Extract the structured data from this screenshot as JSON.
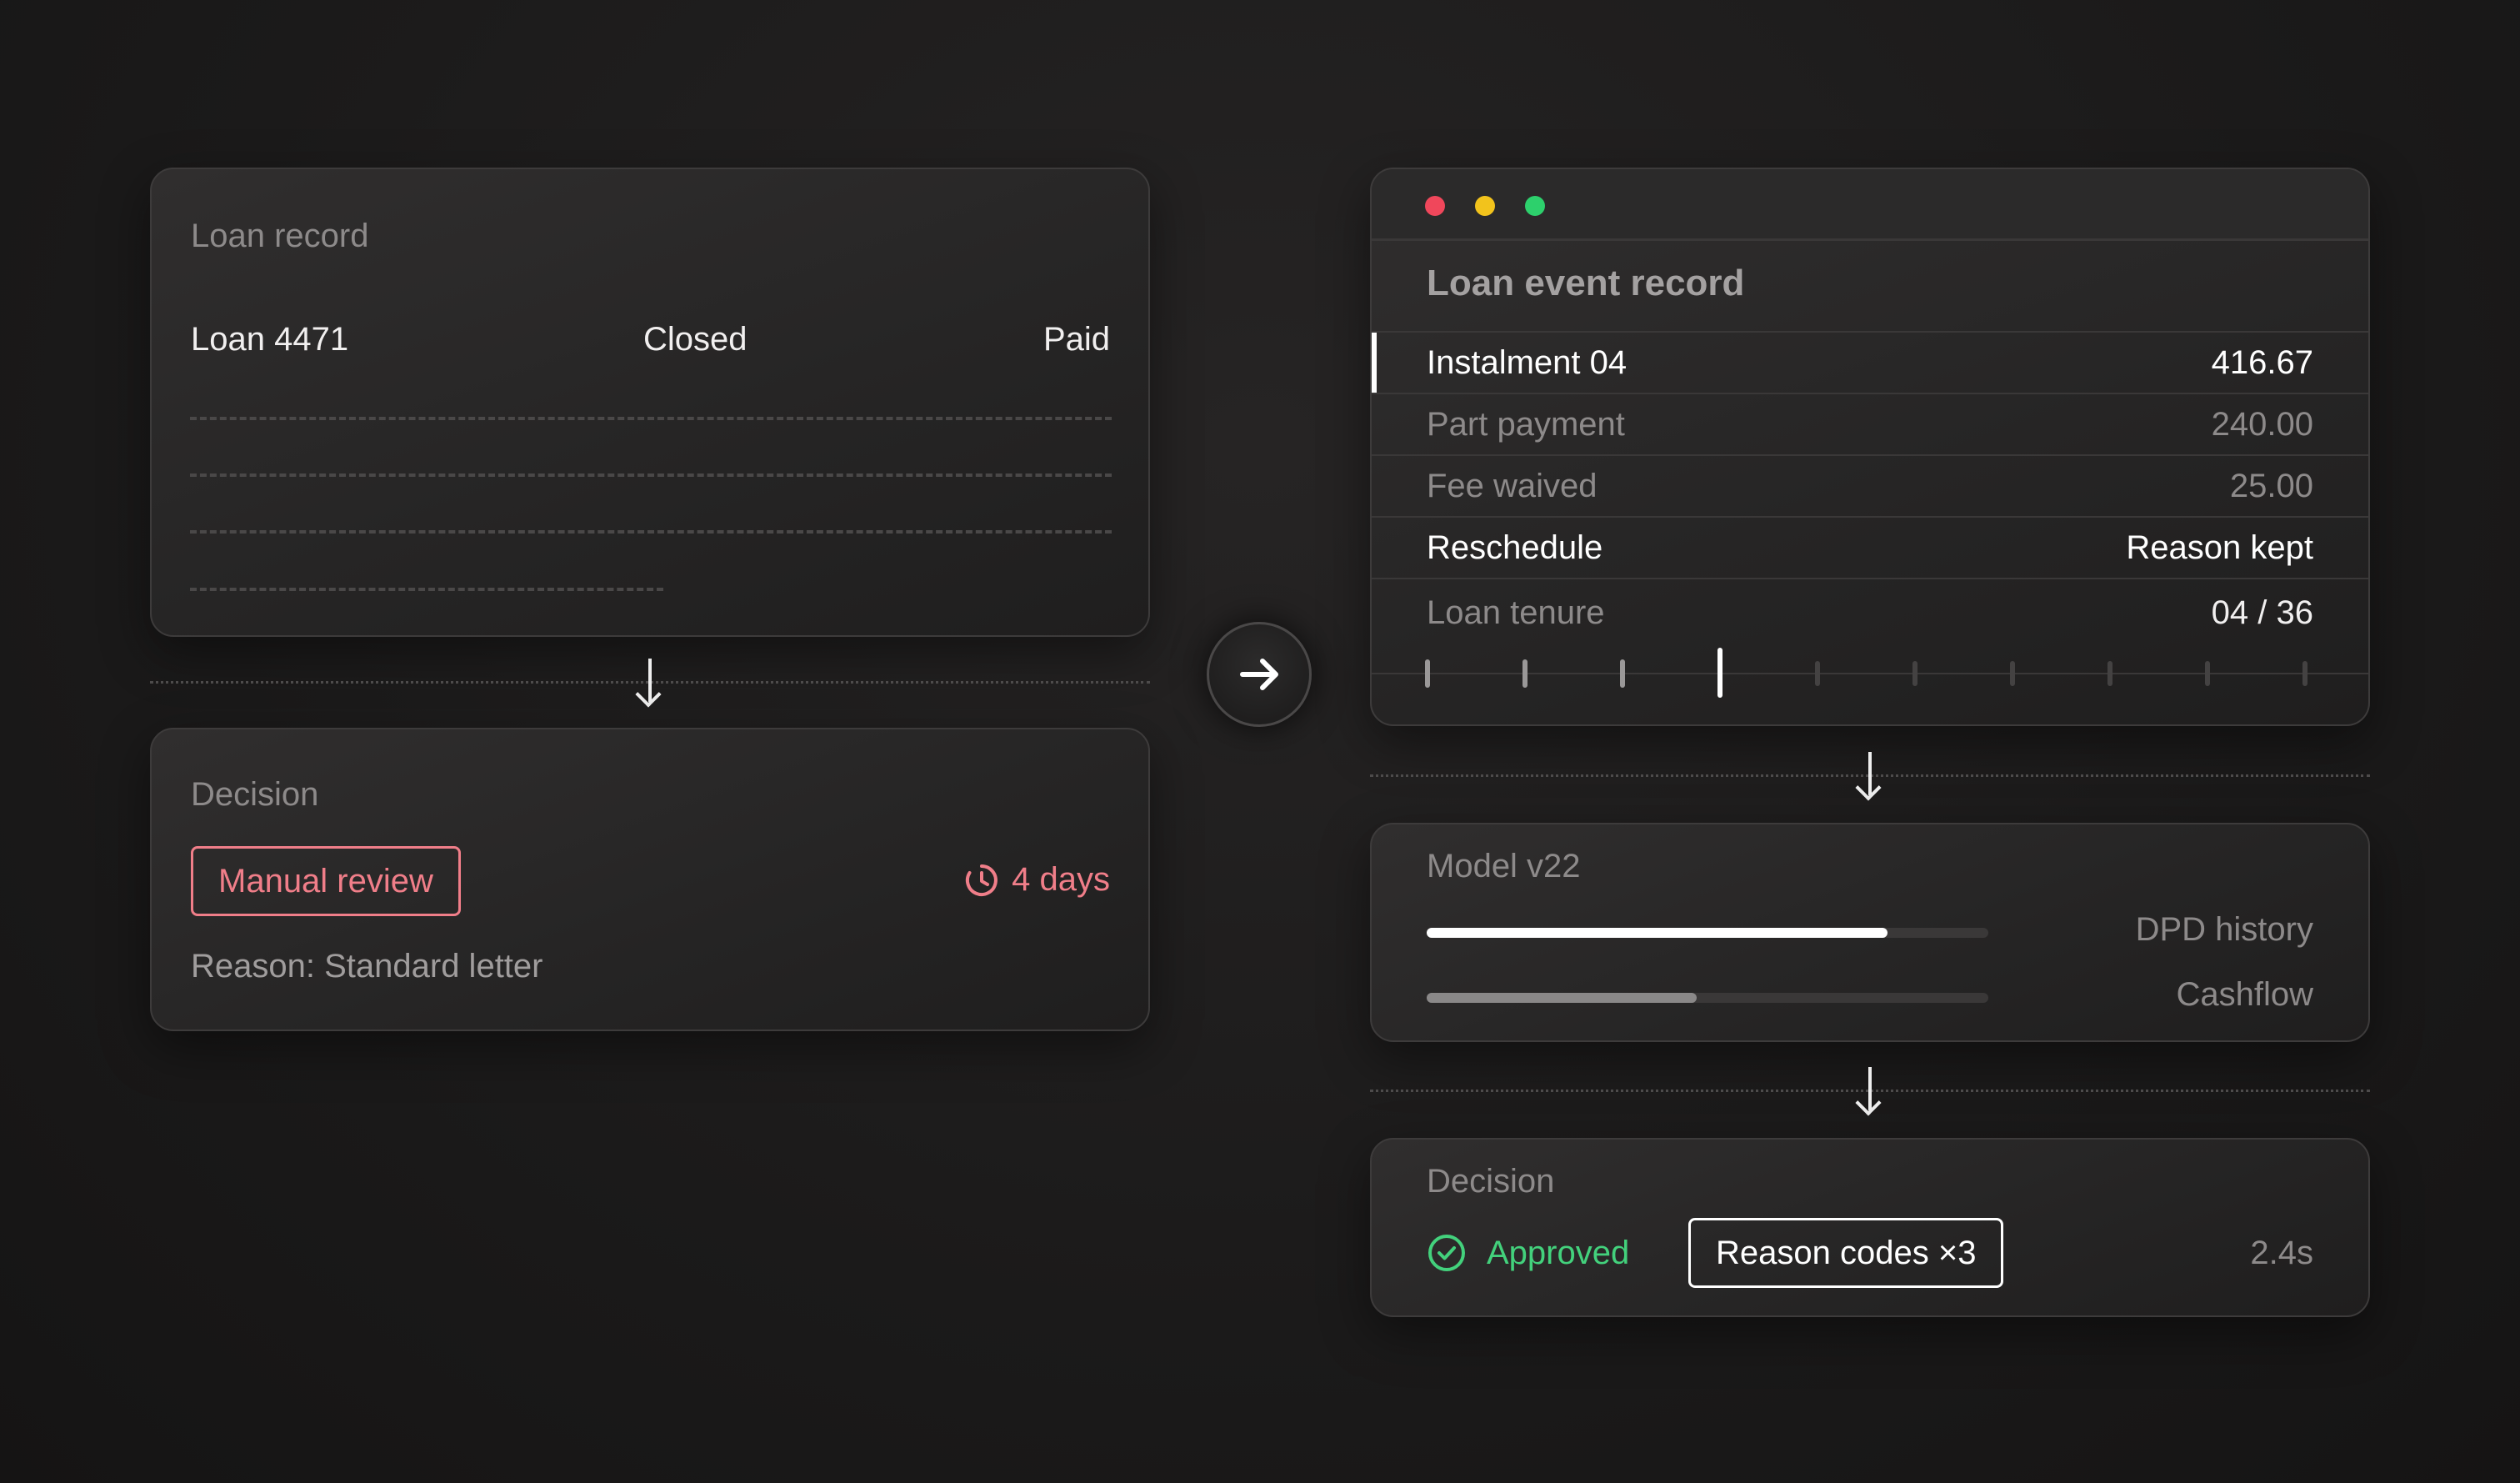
{
  "loan_record": {
    "title": "Loan record",
    "loan_id": "Loan 4471",
    "status": "Closed",
    "payment": "Paid"
  },
  "left_decision": {
    "title": "Decision",
    "badge": "Manual review",
    "duration": "4 days",
    "reason": "Reason: Standard letter"
  },
  "event_record": {
    "title": "Loan event record",
    "rows": [
      {
        "label": "Instalment 04",
        "value": "416.67"
      },
      {
        "label": "Part payment",
        "value": "240.00"
      },
      {
        "label": "Fee waived",
        "value": "25.00"
      },
      {
        "label": "Reschedule",
        "value": "Reason kept"
      }
    ],
    "tenure_label": "Loan tenure",
    "tenure_value": "04 / 36",
    "tenure_current": 4
  },
  "model": {
    "title": "Model v22",
    "features": [
      {
        "name": "DPD history",
        "fraction": 0.82
      },
      {
        "name": "Cashflow",
        "fraction": 0.48
      }
    ]
  },
  "right_decision": {
    "title": "Decision",
    "status": "Approved",
    "reason_codes": "Reason codes ×3",
    "latency": "2.4s"
  },
  "colors": {
    "accent_red": "#f07e89",
    "approved_green": "#43d17c",
    "traffic_red": "#f0475b",
    "traffic_yellow": "#f2c31c",
    "traffic_green": "#2dd06c"
  },
  "icons": {
    "clock": "clock-icon",
    "check": "check-circle-icon",
    "next": "arrow-right-icon",
    "down": "arrow-down-icon"
  }
}
